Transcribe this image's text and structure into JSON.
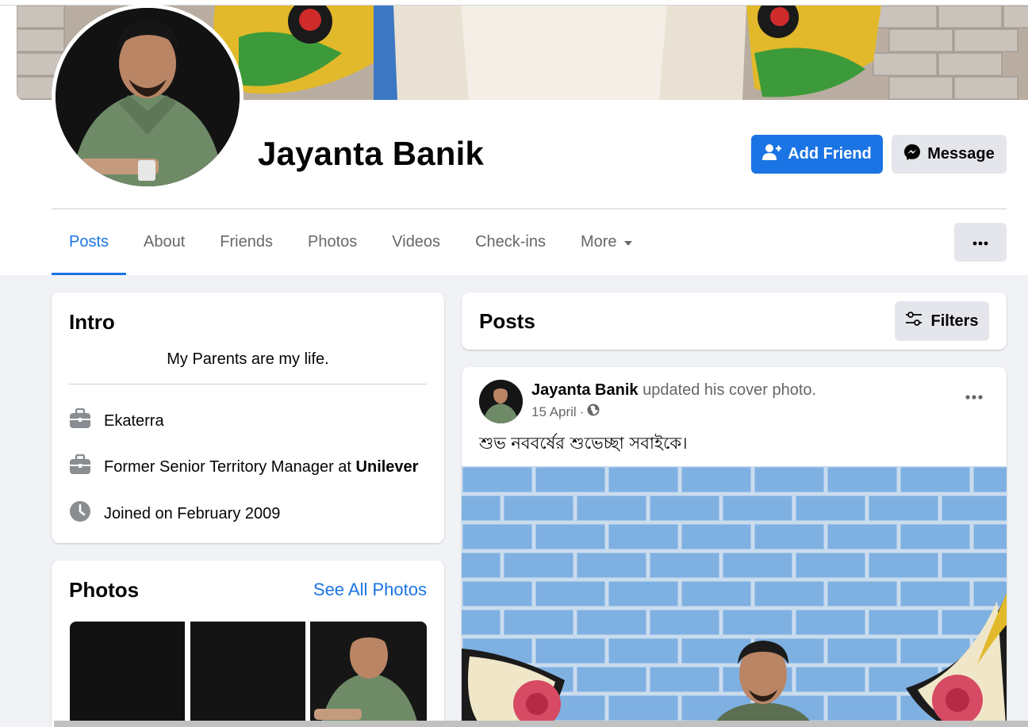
{
  "profile": {
    "name": "Jayanta Banik",
    "add_friend_label": "Add Friend",
    "message_label": "Message"
  },
  "tabs": [
    {
      "label": "Posts",
      "active": true
    },
    {
      "label": "About"
    },
    {
      "label": "Friends"
    },
    {
      "label": "Photos"
    },
    {
      "label": "Videos"
    },
    {
      "label": "Check-ins"
    },
    {
      "label": "More"
    }
  ],
  "intro": {
    "title": "Intro",
    "bio": "My Parents are my life.",
    "items": [
      {
        "icon": "briefcase-icon",
        "text": "Ekaterra"
      },
      {
        "icon": "briefcase-icon",
        "prefix": "Former Senior Territory Manager at ",
        "bold": "Unilever"
      },
      {
        "icon": "clock-icon",
        "text": "Joined on February 2009"
      }
    ]
  },
  "photos": {
    "title": "Photos",
    "see_all_label": "See All Photos"
  },
  "posts_section": {
    "title": "Posts",
    "filters_label": "Filters"
  },
  "post": {
    "author": "Jayanta Banik",
    "action": " updated his cover photo.",
    "date": "15 April",
    "separator": " · ",
    "privacy_icon": "globe-icon",
    "text": "শুভ নববর্ষের শুভেচ্ছা সবাইকে।"
  },
  "colors": {
    "accent": "#1b74e4",
    "secondary_button": "#e4e6eb",
    "page_background": "#f0f2f5",
    "muted_text": "#65676b"
  }
}
